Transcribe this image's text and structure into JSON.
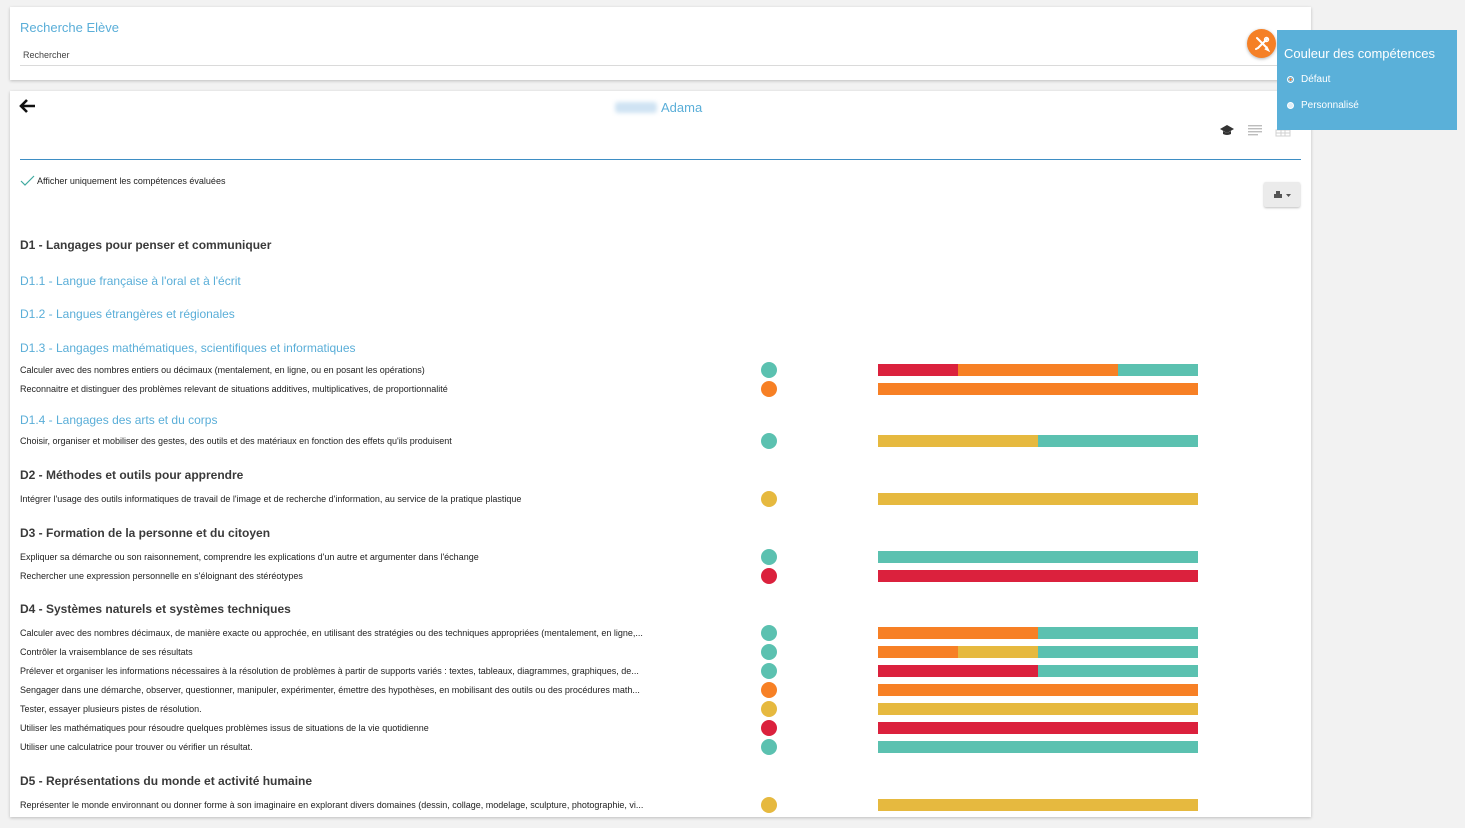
{
  "search": {
    "title": "Recherche Elève",
    "placeholder": "Rechercher"
  },
  "student": {
    "first_name": "Adama"
  },
  "filter": {
    "label": "Afficher uniquement les compétences évaluées"
  },
  "colors": {
    "red": "#db213d",
    "orange": "#f78025",
    "yellow": "#e6b93f",
    "teal": "#5bc1b0",
    "accent_blue": "#5aaed8"
  },
  "color_panel": {
    "title": "Couleur des compétences",
    "options": [
      "Défaut",
      "Personnalisé"
    ],
    "selected": "Défaut"
  },
  "domains": [
    {
      "title": "D1 - Langages pour penser et communiquer"
    },
    {
      "title": "D2 - Méthodes et outils pour apprendre"
    },
    {
      "title": "D3 - Formation de la personne et du citoyen"
    },
    {
      "title": "D4 - Systèmes naturels et systèmes techniques"
    },
    {
      "title": "D5 - Représentations du monde et activité humaine"
    }
  ],
  "subdomains": [
    {
      "title": "D1.1 - Langue française à l'oral et à l'écrit"
    },
    {
      "title": "D1.2 - Langues étrangères et régionales"
    },
    {
      "title": "D1.3 - Langages mathématiques, scientifiques et informatiques"
    },
    {
      "title": "D1.4 - Langages des arts et du corps"
    }
  ],
  "skills": [
    {
      "label": "Calculer avec des nombres entiers ou décimaux (mentalement, en ligne, ou en posant les opérations)",
      "level": "teal",
      "distribution": [
        {
          "color": "red",
          "share": 0.25
        },
        {
          "color": "orange",
          "share": 0.5
        },
        {
          "color": "teal",
          "share": 0.25
        }
      ]
    },
    {
      "label": "Reconnaitre et distinguer des problèmes relevant de situations additives, multiplicatives, de proportionnalité",
      "level": "orange",
      "distribution": [
        {
          "color": "orange",
          "share": 1
        }
      ]
    },
    {
      "label": "Choisir, organiser et mobiliser des gestes, des outils et des matériaux en fonction des effets qu'ils produisent",
      "level": "teal",
      "distribution": [
        {
          "color": "yellow",
          "share": 0.5
        },
        {
          "color": "teal",
          "share": 0.5
        }
      ]
    },
    {
      "label": "Intégrer l'usage des outils informatiques de travail de l'image et de recherche d'information, au service de la pratique plastique",
      "level": "yellow",
      "distribution": [
        {
          "color": "yellow",
          "share": 1
        }
      ]
    },
    {
      "label": "Expliquer sa démarche ou son raisonnement, comprendre les explications d'un autre et argumenter dans l'échange",
      "level": "teal",
      "distribution": [
        {
          "color": "teal",
          "share": 1
        }
      ]
    },
    {
      "label": "Rechercher une expression personnelle en s'éloignant des stéréotypes",
      "level": "red",
      "distribution": [
        {
          "color": "red",
          "share": 1
        }
      ]
    },
    {
      "label": "Calculer avec des nombres décimaux, de manière exacte ou approchée, en utilisant des stratégies ou des techniques appropriées (mentalement, en ligne,...",
      "level": "teal",
      "distribution": [
        {
          "color": "orange",
          "share": 0.5
        },
        {
          "color": "teal",
          "share": 0.5
        }
      ]
    },
    {
      "label": "Contrôler la vraisemblance de ses résultats",
      "level": "teal",
      "distribution": [
        {
          "color": "orange",
          "share": 0.25
        },
        {
          "color": "yellow",
          "share": 0.25
        },
        {
          "color": "teal",
          "share": 0.5
        }
      ]
    },
    {
      "label": "Prélever et organiser les informations nécessaires à la résolution de problèmes à partir de supports variés : textes, tableaux, diagrammes, graphiques, de...",
      "level": "teal",
      "distribution": [
        {
          "color": "red",
          "share": 0.5
        },
        {
          "color": "teal",
          "share": 0.5
        }
      ]
    },
    {
      "label": "Sengager dans une démarche, observer, questionner, manipuler, expérimenter, émettre des hypothèses, en mobilisant des outils ou des procédures math...",
      "level": "orange",
      "distribution": [
        {
          "color": "orange",
          "share": 1
        }
      ]
    },
    {
      "label": "Tester, essayer plusieurs pistes de résolution.",
      "level": "yellow",
      "distribution": [
        {
          "color": "yellow",
          "share": 1
        }
      ]
    },
    {
      "label": "Utiliser les mathématiques pour résoudre quelques problèmes issus de situations de la vie quotidienne",
      "level": "red",
      "distribution": [
        {
          "color": "red",
          "share": 1
        }
      ]
    },
    {
      "label": "Utiliser une calculatrice pour trouver ou vérifier un résultat.",
      "level": "teal",
      "distribution": [
        {
          "color": "teal",
          "share": 1
        }
      ]
    },
    {
      "label": "Représenter le monde environnant ou donner forme à son imaginaire en explorant divers domaines (dessin, collage, modelage, sculpture, photographie, vi...",
      "level": "yellow",
      "distribution": [
        {
          "color": "yellow",
          "share": 1
        }
      ]
    }
  ]
}
